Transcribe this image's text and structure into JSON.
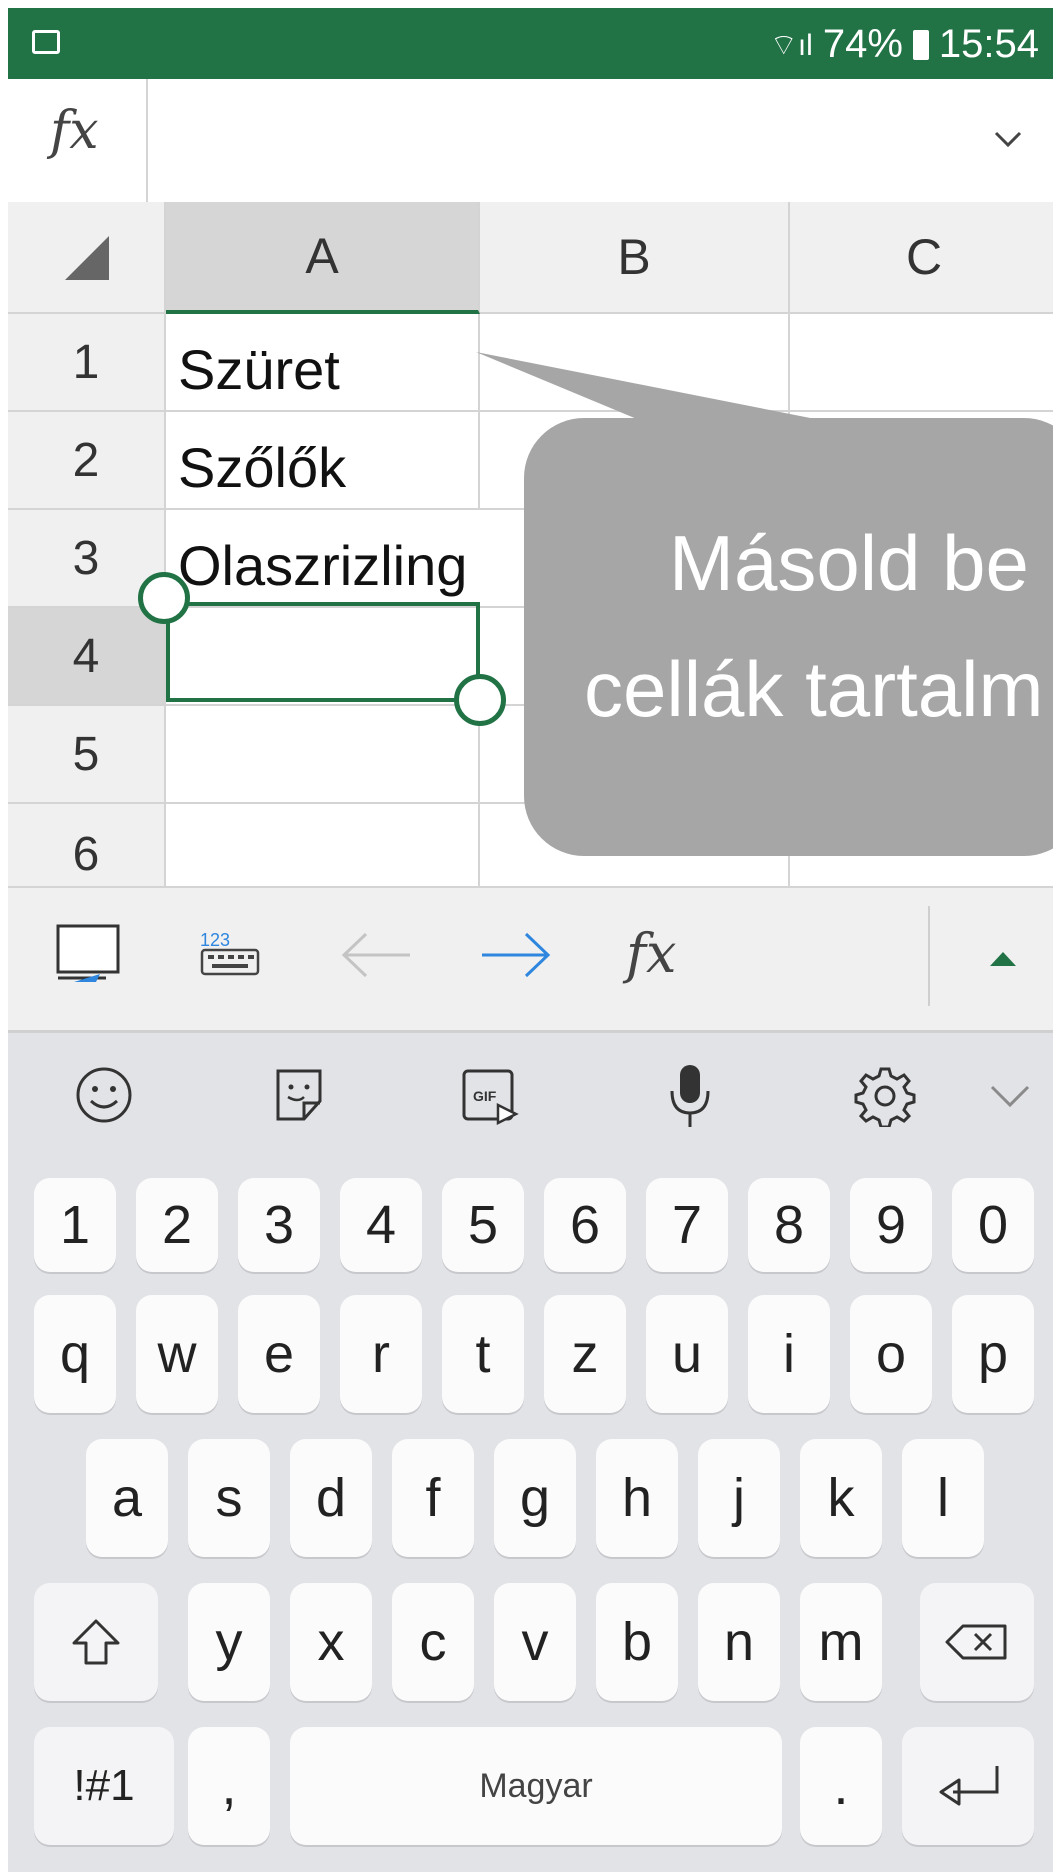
{
  "status_bar": {
    "battery": "74%",
    "time": "15:54"
  },
  "formula_bar": {
    "fx_label": "fx",
    "value": ""
  },
  "grid": {
    "columns": [
      "A",
      "B",
      "C"
    ],
    "rows": [
      {
        "num": "1",
        "a": "Szüret"
      },
      {
        "num": "2",
        "a": "Szőlők"
      },
      {
        "num": "3",
        "a": "Olaszrizling"
      },
      {
        "num": "4",
        "a": ""
      },
      {
        "num": "5",
        "a": ""
      },
      {
        "num": "6",
        "a": ""
      }
    ],
    "selected_cell": "A4"
  },
  "callout": {
    "line1": "Másold be",
    "line2": "cellák tartalm"
  },
  "toolbar": {
    "fx_label": "fx"
  },
  "keyboard": {
    "row1": [
      "1",
      "2",
      "3",
      "4",
      "5",
      "6",
      "7",
      "8",
      "9",
      "0"
    ],
    "row2": [
      "q",
      "w",
      "e",
      "r",
      "t",
      "z",
      "u",
      "i",
      "o",
      "p"
    ],
    "row3": [
      "a",
      "s",
      "d",
      "f",
      "g",
      "h",
      "j",
      "k",
      "l"
    ],
    "row4": [
      "y",
      "x",
      "c",
      "v",
      "b",
      "n",
      "m"
    ],
    "symbols_label": "!#1",
    "comma": ",",
    "space_label": "Magyar",
    "period": "."
  }
}
